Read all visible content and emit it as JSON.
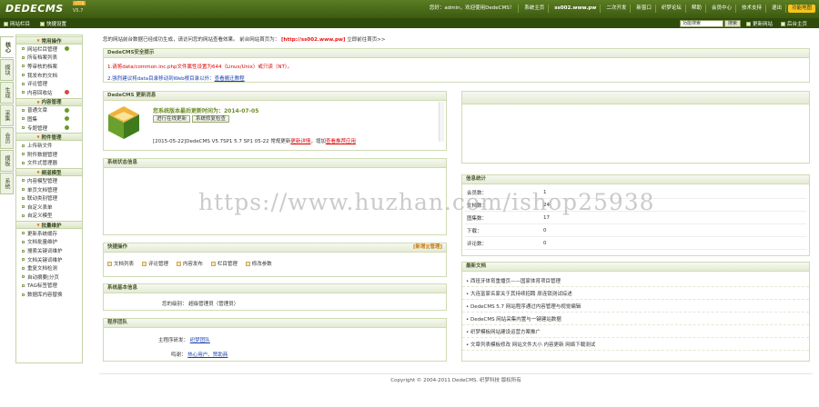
{
  "app": {
    "logo": "DEDECMS",
    "badge": "UTF8",
    "version": "V5.7"
  },
  "topnav": {
    "welcome": "您好：admin，欢迎使用DedeCMS！",
    "items": [
      "新窗口",
      "系统主页",
      "织梦论坛",
      "帮助",
      "退出"
    ],
    "site_label": "系统主页",
    "site_url": "ss002.www.pw",
    "extra": [
      "二次开发",
      "会员中心",
      "技术支持"
    ],
    "quick": "功能地图"
  },
  "toolbar": {
    "left": [
      "网站栏目",
      "快捷设置"
    ],
    "search_value": "功能搜索",
    "search_btn": "搜索",
    "right": [
      "更新网站",
      "后台主页"
    ]
  },
  "sidetabs": [
    "核心",
    "模块",
    "生成",
    "采集",
    "会员",
    "模板",
    "系统"
  ],
  "menu": [
    {
      "title": "常用操作",
      "items": [
        "网站栏目管理",
        "所有档案列表",
        "等审核的档案",
        "我发布的文档",
        "评论管理",
        "内容回收站"
      ]
    },
    {
      "title": "内容管理",
      "items": [
        "普通文章",
        "图集",
        "专题管理"
      ]
    },
    {
      "title": "附件管理",
      "items": [
        "上传新文件",
        "附件数据管理",
        "文件式管理器"
      ]
    },
    {
      "title": "频道模型",
      "items": [
        "内容模型管理",
        "单页文档管理",
        "联动类别管理",
        "自定义表单",
        "自定义模型"
      ]
    },
    {
      "title": "批量维护",
      "items": [
        "更新系统缓存",
        "文档批量维护",
        "搜索关键词维护",
        "文档关键词维护",
        "重复文档检测",
        "自动摘要|分页",
        "TAG标签管理",
        "数据库内容替换"
      ]
    }
  ],
  "notice": {
    "text": "您的网站前台数据已经成功生成，请访问您的网站查看效果。",
    "mid": "前台网站首页为：",
    "url": "[http://ss002.www.pw]",
    "tail": "立即前往首页>>"
  },
  "security": {
    "title": "DedeCMS安全提示",
    "line1": "1.请将data/common.inc.php文件属性设置为644（Linux/Unix）或只读（NT）。",
    "line2_pre": "2.强烈建议将data目录移动到Web根目录以外：",
    "line2_link": "查看搬迁教程"
  },
  "update": {
    "title": "DedeCMS 更新消息",
    "latest": "您系统版本最后更新时间为：2014-07-05",
    "btn1": "进行在线更新",
    "btn2": "系统修复检查",
    "news": "[2015-05-22]DedeCMS V5.7SP1 5.7 SP1 05-22 常规更新",
    "news_link": "更新详情",
    "news_tail": "，增加",
    "news_link2": "查看推荐应用"
  },
  "sys_status": {
    "title": "系统状态信息"
  },
  "info": {
    "title": "信息统计",
    "rows": [
      [
        "会员数：",
        "1"
      ],
      [
        "文档数：",
        "24"
      ],
      [
        "图集数：",
        "17"
      ],
      [
        "下载：",
        "0"
      ],
      [
        "评论数：",
        "0"
      ]
    ]
  },
  "quick": {
    "title": "快捷操作",
    "actions": [
      "[新增]",
      "[管理]"
    ],
    "links": [
      "文档列表",
      "评论管理",
      "内容发布",
      "栏目管理",
      "修改参数"
    ]
  },
  "latest": {
    "title": "最新文档",
    "items": [
      "• 西班牙体育重播页——国家体育项目管理",
      "• 大连富家名家关于其持续招聘 原连锁测试综述",
      "• DedeCMS 5.7 网站程序通过内容管理与视觉编辑",
      "• DedeCMS 网站采集内置与一键建站数据",
      "• 织梦模板网站建设运营方案推广",
      "• 文章列表模板修改 网站文件大小 内容更新 网络下载测试"
    ]
  },
  "sysinfo": {
    "title": "系统基本信息",
    "k": "您的级别：",
    "v": "超级管理员（管理员）"
  },
  "dev": {
    "title": "程序团队",
    "k1": "主程序研发：",
    "v1": "织梦团队",
    "k2": "鸣谢：",
    "v2": "热心用户、赞助商"
  },
  "footer": "Copyright © 2004-2011 DedeCMS. 织梦科技 版权所有",
  "watermark": "https://www.huzhan.com/ishop25938"
}
